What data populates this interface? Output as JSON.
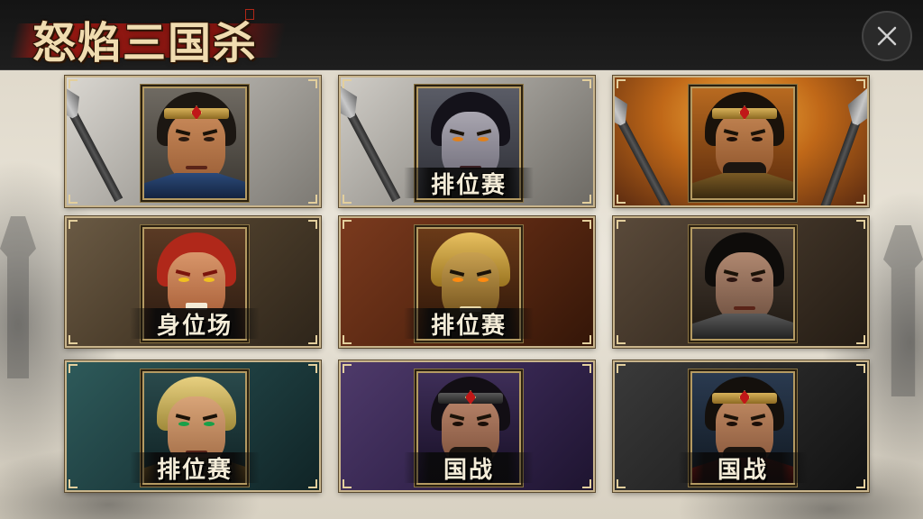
{
  "app": {
    "title": "怒焰三国杀"
  },
  "header": {
    "close_icon": "close-icon"
  },
  "modes": [
    {
      "id": "mode-1",
      "label": "",
      "theme": "grey",
      "portrait": "hero-headband-young"
    },
    {
      "id": "mode-2",
      "label": "排位赛",
      "theme": "grey",
      "portrait": "hero-pale-demon"
    },
    {
      "id": "mode-3",
      "label": "",
      "theme": "fire-gold",
      "portrait": "hero-bearded-general"
    },
    {
      "id": "mode-4",
      "label": "身位场",
      "theme": "brown",
      "portrait": "hero-red-ogre"
    },
    {
      "id": "mode-5",
      "label": "排位赛",
      "theme": "rust",
      "portrait": "hero-golden-skull"
    },
    {
      "id": "mode-6",
      "label": "",
      "theme": "dark-brown",
      "portrait": "hero-scarred-warrior"
    },
    {
      "id": "mode-7",
      "label": "排位赛",
      "theme": "teal",
      "portrait": "hero-blond-elf"
    },
    {
      "id": "mode-8",
      "label": "国战",
      "theme": "purple",
      "portrait": "hero-bearded-brute"
    },
    {
      "id": "mode-9",
      "label": "国战",
      "theme": "charcoal",
      "portrait": "hero-crowned-lord"
    }
  ],
  "colors": {
    "frame_gold": "#c9b58c",
    "title_cream": "#f0dcb0",
    "title_brush_red": "#a0190f",
    "topbar": "#1a1a1a"
  }
}
